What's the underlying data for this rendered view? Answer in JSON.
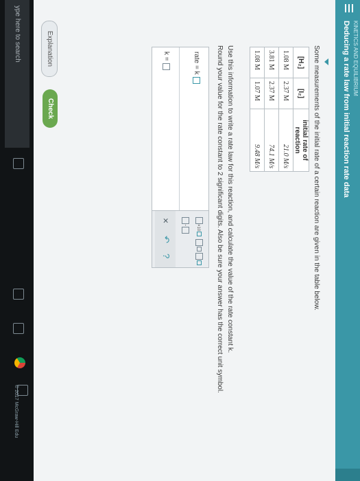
{
  "header": {
    "subtitle": "KINETICS AND EQUILIBRIUM",
    "title": "Deducing a rate law from initial reaction rate data"
  },
  "problem": {
    "intro": "Some measurements of the initial rate of a certain reaction are given in the table below.",
    "use_text": "Use this information to write a rate law for this reaction, and calculate the value of the rate constant k.",
    "round_text": "Round your value for the rate constant to 2 significant digits. Also be sure your answer has the correct unit symbol."
  },
  "table": {
    "headers": [
      "[H₂]",
      "[I₂]",
      "initial rate of reaction"
    ],
    "rows": [
      [
        "1.08 M",
        "2.37 M",
        "21.0 M/s"
      ],
      [
        "3.81 M",
        "2.37 M",
        "74.1 M/s"
      ],
      [
        "1.08 M",
        "1.07 M",
        "9.48 M/s"
      ]
    ]
  },
  "answer": {
    "rate_label": "rate = k",
    "k_label": "k ="
  },
  "palette": {
    "times_ten": "×10",
    "dot": "·",
    "clear": "×",
    "undo": "↶",
    "help": "?"
  },
  "buttons": {
    "explanation": "Explanation",
    "check": "Check"
  },
  "taskbar": {
    "search_text": "ype here to search"
  },
  "footer": {
    "copyright": "© 2017 McGraw-Hill Edu"
  },
  "colors": {
    "accent": "#3a97a7",
    "check_green": "#6aa84f"
  }
}
